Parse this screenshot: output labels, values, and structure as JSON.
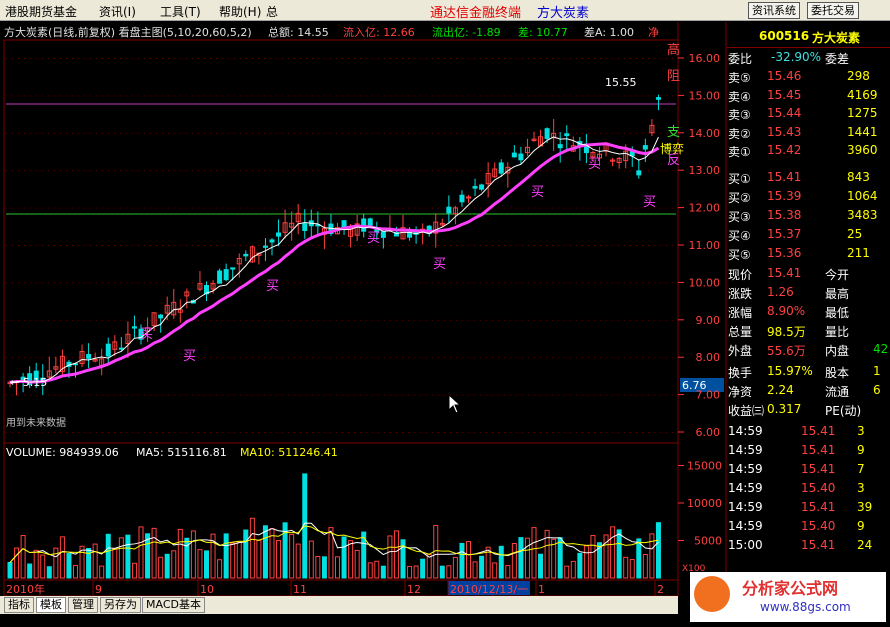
{
  "menu": {
    "items": [
      "港股期货基金",
      "资讯(I)",
      "工具(T)",
      "帮助(H)",
      "总"
    ],
    "center1": "通达信金融终端",
    "center2": "方大炭素",
    "btn1": "资讯系统",
    "btn2": "委托交易"
  },
  "info": {
    "title": "方大炭素(日线,前复权) 看盘主图(5,10,20,60,5,2)",
    "zongjin": "总额: 14.55",
    "liuru": "流入亿: 12.66",
    "liuchu": "流出亿: -1.89",
    "cha": "差: 10.77",
    "chaA": "差A: 1.00",
    "jing": "净"
  },
  "right_labels": {
    "gao": "高",
    "zu": "阻",
    "zhi": "支",
    "bo": "博弈",
    "fan": "反"
  },
  "price_axis": [
    "16.00",
    "15.00",
    "14.00",
    "13.00",
    "12.00",
    "11.00",
    "10.00",
    "9.00",
    "8.00",
    "7.00",
    "6.00"
  ],
  "price_marker": "6.76",
  "annotations": {
    "peak": "15.55",
    "low": "5.15",
    "nodata": "用到未来数据",
    "buy": "买"
  },
  "volume": {
    "label": "VOLUME: 984939.06",
    "ma5": "MA5: 515116.81",
    "ma10": "MA10: 511246.41",
    "axis": [
      "15000",
      "10000",
      "5000"
    ],
    "unit": "X100"
  },
  "dates": [
    "2010年",
    "9",
    "10",
    "11",
    "12",
    "2010/12/13/一",
    "1",
    "2"
  ],
  "bottom_tabs": [
    "指标",
    "模板",
    "管理",
    "另存为",
    "MACD基本"
  ],
  "quote": {
    "code": "600516",
    "name": "方大炭素",
    "weibi_label": "委比",
    "weibi": "-32.90%",
    "weicha_label": "委差",
    "sell": [
      {
        "l": "卖⑤",
        "p": "15.46",
        "v": "298"
      },
      {
        "l": "卖④",
        "p": "15.45",
        "v": "4169"
      },
      {
        "l": "卖③",
        "p": "15.44",
        "v": "1275"
      },
      {
        "l": "卖②",
        "p": "15.43",
        "v": "1441"
      },
      {
        "l": "卖①",
        "p": "15.42",
        "v": "3960"
      }
    ],
    "buy": [
      {
        "l": "买①",
        "p": "15.41",
        "v": "843"
      },
      {
        "l": "买②",
        "p": "15.39",
        "v": "1064"
      },
      {
        "l": "买③",
        "p": "15.38",
        "v": "3483"
      },
      {
        "l": "买④",
        "p": "15.37",
        "v": "25"
      },
      {
        "l": "买⑤",
        "p": "15.36",
        "v": "211"
      }
    ],
    "stats": [
      {
        "a": "现价",
        "b": "15.41",
        "c": "今开"
      },
      {
        "a": "涨跌",
        "b": "1.26",
        "c": "最高"
      },
      {
        "a": "涨幅",
        "b": "8.90%",
        "c": "最低"
      },
      {
        "a": "总量",
        "b": "98.5万",
        "c": "量比"
      },
      {
        "a": "外盘",
        "b": "55.6万",
        "c": "内盘",
        "d": "42"
      }
    ],
    "stats2": [
      {
        "a": "换手",
        "b": "15.97%",
        "c": "股本",
        "d": "1"
      },
      {
        "a": "净资",
        "b": "2.24",
        "c": "流通",
        "d": "6"
      },
      {
        "a": "收益㈢",
        "b": "0.317",
        "c": "PE(动)"
      }
    ],
    "ticks": [
      {
        "t": "14:59",
        "p": "15.41",
        "v": "3"
      },
      {
        "t": "14:59",
        "p": "15.41",
        "v": "9"
      },
      {
        "t": "14:59",
        "p": "15.41",
        "v": "7"
      },
      {
        "t": "14:59",
        "p": "15.40",
        "v": "3"
      },
      {
        "t": "14:59",
        "p": "15.41",
        "v": "39"
      },
      {
        "t": "14:59",
        "p": "15.40",
        "v": "9"
      },
      {
        "t": "15:00",
        "p": "15.41",
        "v": "24"
      }
    ]
  },
  "watermark": {
    "name": "分析家公式网",
    "url": "www.88gs.com"
  },
  "colors": {
    "up": "#ff4040",
    "down": "#00e0e0",
    "ma": "#ff40ff",
    "bg": "#000000"
  }
}
